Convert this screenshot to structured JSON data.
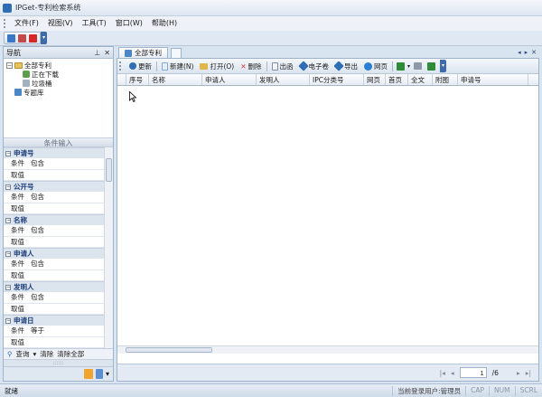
{
  "window": {
    "title": "IPGet-专利检索系统"
  },
  "menu": [
    "文件(F)",
    "视图(V)",
    "工具(T)",
    "窗口(W)",
    "帮助(H)"
  ],
  "nav": {
    "title": "导航",
    "tree": [
      {
        "label": "全部专利",
        "level": 0,
        "icon": "folder-icon"
      },
      {
        "label": "正在下载",
        "level": 1,
        "icon": "download-icon"
      },
      {
        "label": "垃圾桶",
        "level": 1,
        "icon": "trash-icon"
      },
      {
        "label": "专题库",
        "level": 0,
        "icon": "library-icon"
      }
    ]
  },
  "conditions": {
    "title": "条件输入",
    "groups": [
      {
        "name": "申请号",
        "rows": [
          {
            "k": "条件",
            "v": "包含"
          },
          {
            "k": "取值",
            "v": ""
          }
        ]
      },
      {
        "name": "公开号",
        "rows": [
          {
            "k": "条件",
            "v": "包含"
          },
          {
            "k": "取值",
            "v": ""
          }
        ]
      },
      {
        "name": "名称",
        "rows": [
          {
            "k": "条件",
            "v": "包含"
          },
          {
            "k": "取值",
            "v": ""
          }
        ]
      },
      {
        "name": "申请人",
        "rows": [
          {
            "k": "条件",
            "v": "包含"
          },
          {
            "k": "取值",
            "v": ""
          }
        ]
      },
      {
        "name": "发明人",
        "rows": [
          {
            "k": "条件",
            "v": "包含"
          },
          {
            "k": "取值",
            "v": ""
          }
        ]
      },
      {
        "name": "申请日",
        "rows": [
          {
            "k": "条件",
            "v": "等于"
          },
          {
            "k": "取值",
            "v": ""
          }
        ]
      }
    ],
    "actions": {
      "search": "查询",
      "clear": "清除",
      "clear_all": "清除全部"
    }
  },
  "tabs": {
    "active": "全部专利"
  },
  "doc_toolbar": [
    {
      "label": "更新",
      "icon": "refresh-icon",
      "color": "#2f6db5"
    },
    {
      "label": "新建(N)",
      "icon": "new-icon",
      "color": "#7fa7d9"
    },
    {
      "label": "打开(O)",
      "icon": "open-icon",
      "color": "#e0b64a"
    },
    {
      "label": "删除",
      "icon": "delete-icon",
      "color": "#d33"
    },
    {
      "label": "出函",
      "icon": "letter-icon",
      "color": "#7d8fa9"
    },
    {
      "label": "电子卷",
      "icon": "ebook-icon",
      "color": "#2f6db5"
    },
    {
      "label": "导出",
      "icon": "export-icon",
      "color": "#2f6db5"
    },
    {
      "label": "网页",
      "icon": "web-icon",
      "color": "#2a7fd4"
    }
  ],
  "grid": {
    "columns": [
      "序号",
      "名称",
      "申请人",
      "发明人",
      "IPC分类号",
      "网页",
      "首页",
      "全文",
      "附图",
      "申请号"
    ]
  },
  "pager": {
    "current": "1",
    "total": "/6"
  },
  "status": {
    "left": "就绪",
    "user": "当前登录用户:管理员",
    "caps": "CAP",
    "num": "NUM",
    "scrl": "SCRL"
  }
}
